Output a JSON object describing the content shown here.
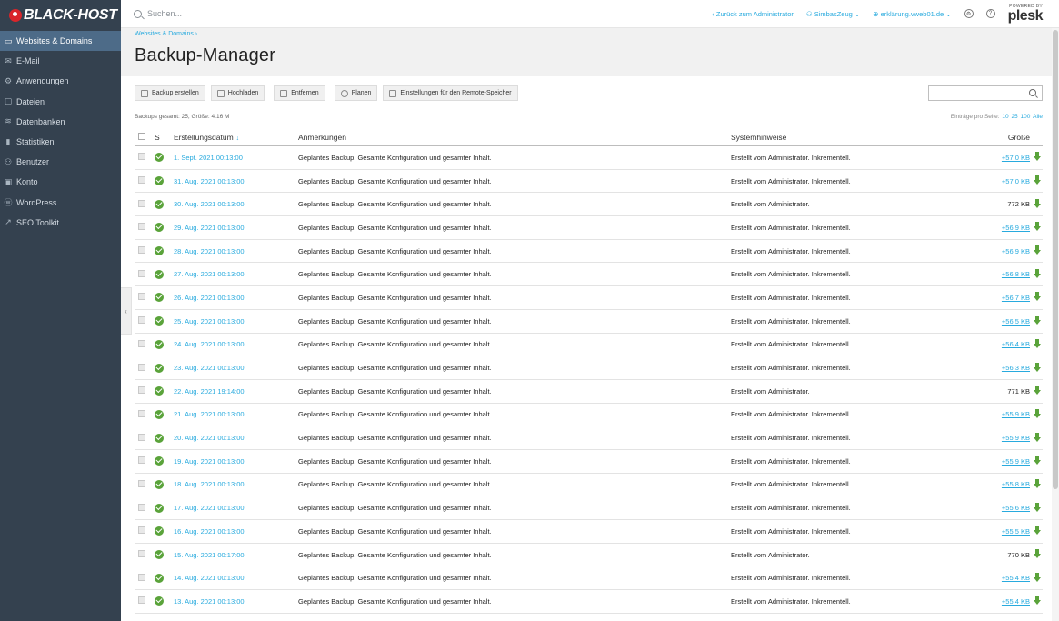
{
  "brand": {
    "logo_text": "BLACK-HOST"
  },
  "sidebar": {
    "items": [
      {
        "label": "Websites & Domains",
        "icon": "monitor-icon"
      },
      {
        "label": "E-Mail",
        "icon": "mail-icon"
      },
      {
        "label": "Anwendungen",
        "icon": "gear-icon"
      },
      {
        "label": "Dateien",
        "icon": "folder-icon"
      },
      {
        "label": "Datenbanken",
        "icon": "database-icon"
      },
      {
        "label": "Statistiken",
        "icon": "bar-chart-icon"
      },
      {
        "label": "Benutzer",
        "icon": "user-icon"
      },
      {
        "label": "Konto",
        "icon": "account-icon"
      },
      {
        "label": "WordPress",
        "icon": "wordpress-icon"
      },
      {
        "label": "SEO Toolkit",
        "icon": "seo-icon"
      }
    ]
  },
  "topbar": {
    "search_placeholder": "Suchen...",
    "back_link": "‹  Zurück zum Administrator",
    "user": "SimbasZeug ⌄",
    "domain": "erklärung.vweb01.de ⌄",
    "powered_by": "POWERED BY",
    "plesk": "plesk"
  },
  "breadcrumb": "Websites & Domains  ›",
  "page_title": "Backup-Manager",
  "toolbar": {
    "create": "Backup erstellen",
    "upload": "Hochladen",
    "remove": "Entfernen",
    "schedule": "Planen",
    "remote": "Einstellungen für den Remote-Speicher"
  },
  "summary": "Backups gesamt: 25, Größe: 4.16 M",
  "perpage": {
    "label": "Einträge pro Seite:",
    "o10": "10",
    "o25": "25",
    "o100": "100",
    "all": "Alle"
  },
  "table": {
    "headers": {
      "s": "S",
      "date": "Erstellungsdatum",
      "sort": "↓",
      "notes": "Anmerkungen",
      "sys": "Systemhinweise",
      "size": "Größe"
    },
    "rows": [
      {
        "date": "1. Sept. 2021 00:13:00",
        "note": "Geplantes Backup. Gesamte Konfiguration und gesamter Inhalt.",
        "sys": "Erstellt vom Administrator. Inkrementell.",
        "size": "+57.0 KB",
        "inc": true
      },
      {
        "date": "31. Aug. 2021 00:13:00",
        "note": "Geplantes Backup. Gesamte Konfiguration und gesamter Inhalt.",
        "sys": "Erstellt vom Administrator. Inkrementell.",
        "size": "+57.0 KB",
        "inc": true
      },
      {
        "date": "30. Aug. 2021 00:13:00",
        "note": "Geplantes Backup. Gesamte Konfiguration und gesamter Inhalt.",
        "sys": "Erstellt vom Administrator.",
        "size": "772 KB",
        "inc": false
      },
      {
        "date": "29. Aug. 2021 00:13:00",
        "note": "Geplantes Backup. Gesamte Konfiguration und gesamter Inhalt.",
        "sys": "Erstellt vom Administrator. Inkrementell.",
        "size": "+56.9 KB",
        "inc": true
      },
      {
        "date": "28. Aug. 2021 00:13:00",
        "note": "Geplantes Backup. Gesamte Konfiguration und gesamter Inhalt.",
        "sys": "Erstellt vom Administrator. Inkrementell.",
        "size": "+56.9 KB",
        "inc": true
      },
      {
        "date": "27. Aug. 2021 00:13:00",
        "note": "Geplantes Backup. Gesamte Konfiguration und gesamter Inhalt.",
        "sys": "Erstellt vom Administrator. Inkrementell.",
        "size": "+56.8 KB",
        "inc": true
      },
      {
        "date": "26. Aug. 2021 00:13:00",
        "note": "Geplantes Backup. Gesamte Konfiguration und gesamter Inhalt.",
        "sys": "Erstellt vom Administrator. Inkrementell.",
        "size": "+56.7 KB",
        "inc": true
      },
      {
        "date": "25. Aug. 2021 00:13:00",
        "note": "Geplantes Backup. Gesamte Konfiguration und gesamter Inhalt.",
        "sys": "Erstellt vom Administrator. Inkrementell.",
        "size": "+56.5 KB",
        "inc": true
      },
      {
        "date": "24. Aug. 2021 00:13:00",
        "note": "Geplantes Backup. Gesamte Konfiguration und gesamter Inhalt.",
        "sys": "Erstellt vom Administrator. Inkrementell.",
        "size": "+56.4 KB",
        "inc": true
      },
      {
        "date": "23. Aug. 2021 00:13:00",
        "note": "Geplantes Backup. Gesamte Konfiguration und gesamter Inhalt.",
        "sys": "Erstellt vom Administrator. Inkrementell.",
        "size": "+56.3 KB",
        "inc": true
      },
      {
        "date": "22. Aug. 2021 19:14:00",
        "note": "Geplantes Backup. Gesamte Konfiguration und gesamter Inhalt.",
        "sys": "Erstellt vom Administrator.",
        "size": "771 KB",
        "inc": false
      },
      {
        "date": "21. Aug. 2021 00:13:00",
        "note": "Geplantes Backup. Gesamte Konfiguration und gesamter Inhalt.",
        "sys": "Erstellt vom Administrator. Inkrementell.",
        "size": "+55.9 KB",
        "inc": true
      },
      {
        "date": "20. Aug. 2021 00:13:00",
        "note": "Geplantes Backup. Gesamte Konfiguration und gesamter Inhalt.",
        "sys": "Erstellt vom Administrator. Inkrementell.",
        "size": "+55.9 KB",
        "inc": true
      },
      {
        "date": "19. Aug. 2021 00:13:00",
        "note": "Geplantes Backup. Gesamte Konfiguration und gesamter Inhalt.",
        "sys": "Erstellt vom Administrator. Inkrementell.",
        "size": "+55.9 KB",
        "inc": true
      },
      {
        "date": "18. Aug. 2021 00:13:00",
        "note": "Geplantes Backup. Gesamte Konfiguration und gesamter Inhalt.",
        "sys": "Erstellt vom Administrator. Inkrementell.",
        "size": "+55.8 KB",
        "inc": true
      },
      {
        "date": "17. Aug. 2021 00:13:00",
        "note": "Geplantes Backup. Gesamte Konfiguration und gesamter Inhalt.",
        "sys": "Erstellt vom Administrator. Inkrementell.",
        "size": "+55.6 KB",
        "inc": true
      },
      {
        "date": "16. Aug. 2021 00:13:00",
        "note": "Geplantes Backup. Gesamte Konfiguration und gesamter Inhalt.",
        "sys": "Erstellt vom Administrator. Inkrementell.",
        "size": "+55.5 KB",
        "inc": true
      },
      {
        "date": "15. Aug. 2021 00:17:00",
        "note": "Geplantes Backup. Gesamte Konfiguration und gesamter Inhalt.",
        "sys": "Erstellt vom Administrator.",
        "size": "770 KB",
        "inc": false
      },
      {
        "date": "14. Aug. 2021 00:13:00",
        "note": "Geplantes Backup. Gesamte Konfiguration und gesamter Inhalt.",
        "sys": "Erstellt vom Administrator. Inkrementell.",
        "size": "+55.4 KB",
        "inc": true
      },
      {
        "date": "13. Aug. 2021 00:13:00",
        "note": "Geplantes Backup. Gesamte Konfiguration und gesamter Inhalt.",
        "sys": "Erstellt vom Administrator. Inkrementell.",
        "size": "+55.4 KB",
        "inc": true
      }
    ]
  }
}
